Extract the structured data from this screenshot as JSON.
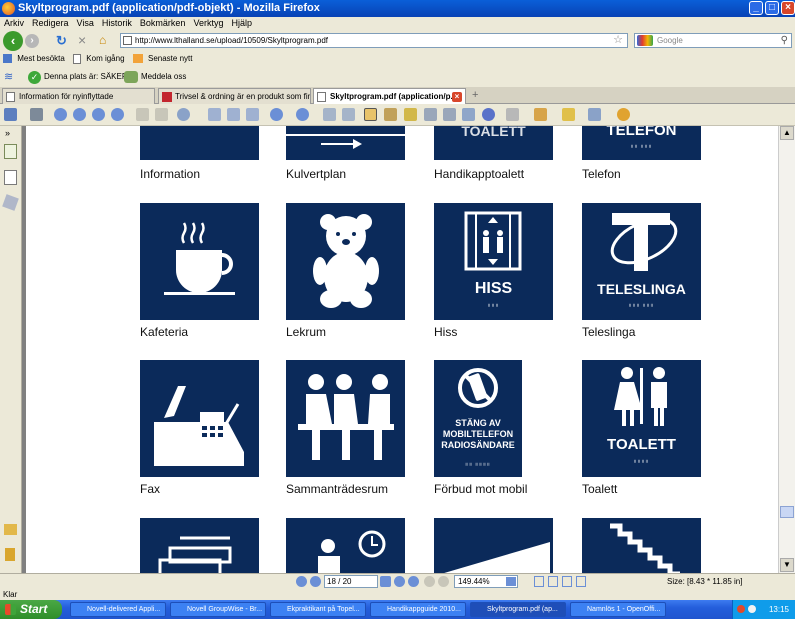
{
  "window": {
    "title": "Skyltprogram.pdf (application/pdf-objekt) - Mozilla Firefox",
    "controls": [
      "_",
      "□",
      "×"
    ]
  },
  "menu": [
    "Arkiv",
    "Redigera",
    "Visa",
    "Historik",
    "Bokmärken",
    "Verktyg",
    "Hjälp"
  ],
  "nav": {
    "url": "http://www.lthalland.se/upload/10509/Skyltprogram.pdf",
    "search_placeholder": "Google"
  },
  "bookmarks": [
    "Mest besökta",
    "Kom igång",
    "Senaste nytt"
  ],
  "addon_bar": {
    "security": "Denna plats är: SÄKER",
    "share": "Meddela oss"
  },
  "tabs": [
    {
      "label": "Information för nyinflyttade",
      "active": false
    },
    {
      "label": "Trivsel & ordning är en produkt som fin...",
      "active": false
    },
    {
      "label": "Skyltprogram.pdf (application/p...",
      "active": true
    }
  ],
  "signs": [
    {
      "label": "Information",
      "text": "",
      "kind": "info"
    },
    {
      "label": "Kulvertplan",
      "text": "",
      "kind": "kulvert"
    },
    {
      "label": "Handikapptoalett",
      "text": "TOALETT",
      "kind": "toalett-top"
    },
    {
      "label": "Telefon",
      "text": "TELEFON",
      "kind": "telefon-top"
    },
    {
      "label": "Kafeteria",
      "text": "",
      "kind": "cafe"
    },
    {
      "label": "Lekrum",
      "text": "",
      "kind": "teddy"
    },
    {
      "label": "Hiss",
      "text": "HISS",
      "kind": "hiss"
    },
    {
      "label": "Teleslinga",
      "text": "TELESLINGA",
      "kind": "teleslinga"
    },
    {
      "label": "Fax",
      "text": "",
      "kind": "fax"
    },
    {
      "label": "Sammanträdesrum",
      "text": "",
      "kind": "meeting"
    },
    {
      "label": "Förbud mot mobil",
      "text": "STÄNG AV MOBILTELEFON RADIOSÄNDARE",
      "kind": "mobil"
    },
    {
      "label": "Toalett",
      "text": "TOALETT",
      "kind": "toalett"
    },
    {
      "label": "",
      "text": "",
      "kind": "partial-1"
    },
    {
      "label": "",
      "text": "",
      "kind": "partial-2"
    },
    {
      "label": "",
      "text": "",
      "kind": "partial-3"
    },
    {
      "label": "",
      "text": "",
      "kind": "partial-4"
    }
  ],
  "pdf_bottom": {
    "page_current": "18",
    "page_total": "/ 20",
    "zoom": "149.44%",
    "size": "Size: [8.43 * 11.85 in]"
  },
  "status": "Klar",
  "taskbar": {
    "start": "Start",
    "items": [
      {
        "label": "Novell-delivered Appli...",
        "active": false
      },
      {
        "label": "Novell GroupWise - Br...",
        "active": false
      },
      {
        "label": "Ekpraktikant på Topel...",
        "active": false
      },
      {
        "label": "Handikappguide 2010...",
        "active": false
      },
      {
        "label": "Skyltprogram.pdf (ap...",
        "active": true
      },
      {
        "label": "Namnlös 1 - OpenOffi...",
        "active": false
      }
    ],
    "clock": "13:15"
  },
  "colors": {
    "sign_bg": "#0b2a5a",
    "titlebar": "#0842b5",
    "taskbar": "#245edb",
    "start": "#2f8e2a"
  }
}
